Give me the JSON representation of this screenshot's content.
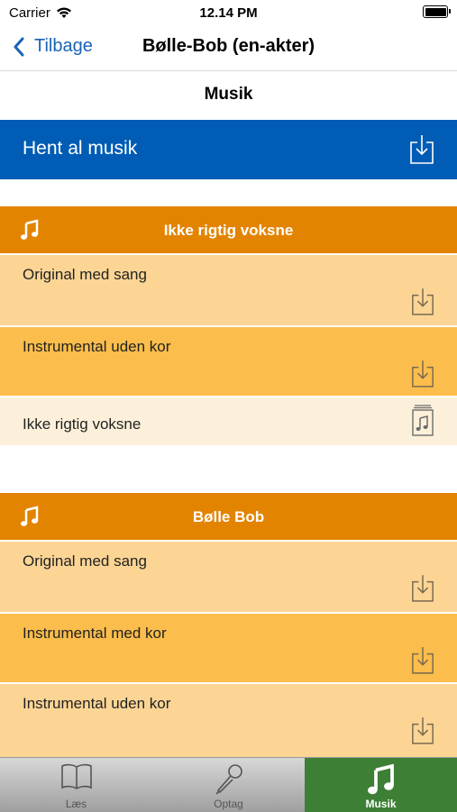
{
  "status": {
    "carrier": "Carrier",
    "time": "12.14 PM"
  },
  "nav": {
    "back_label": "Tilbage",
    "title": "Bølle-Bob (en-akter)"
  },
  "section_title": "Musik",
  "download_all": {
    "label": "Hent al musik"
  },
  "groups": [
    {
      "title": "Ikke rigtig voksne",
      "rows": [
        {
          "label": "Original med sang",
          "icon": "download-icon"
        },
        {
          "label": "Instrumental uden kor",
          "icon": "download-icon"
        },
        {
          "label": "Ikke rigtig voksne",
          "icon": "sheet-music-icon"
        }
      ]
    },
    {
      "title": "Bølle Bob",
      "rows": [
        {
          "label": "Original med sang",
          "icon": "download-icon"
        },
        {
          "label": "Instrumental med kor",
          "icon": "download-icon"
        },
        {
          "label": "Instrumental uden kor",
          "icon": "download-icon"
        }
      ]
    }
  ],
  "tabs": [
    {
      "label": "Læs",
      "icon": "book-icon",
      "active": false
    },
    {
      "label": "Optag",
      "icon": "microphone-icon",
      "active": false
    },
    {
      "label": "Musik",
      "icon": "music-note-icon",
      "active": true
    }
  ],
  "colors": {
    "accent_blue": "#005cb4",
    "group_orange": "#e38400",
    "row_light": "#fcd595",
    "row_dark": "#fbbd4b",
    "tab_active": "#3d7f35"
  }
}
